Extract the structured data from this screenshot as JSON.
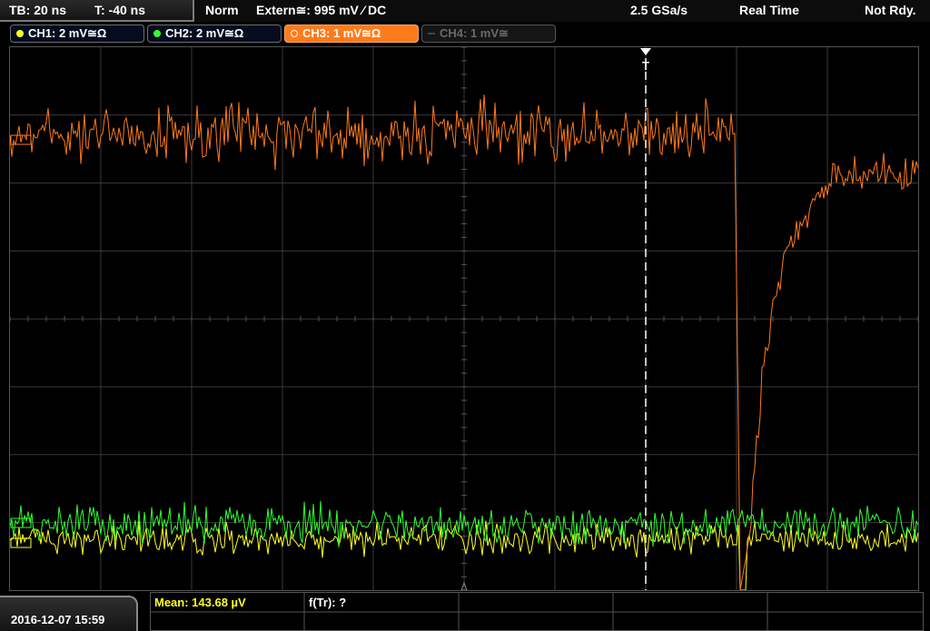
{
  "status": {
    "timebase": "TB: 20 ns",
    "trigger_time": "T: -40 ns",
    "mode": "Norm",
    "trigger_source": "Extern≅: 995 mV ⁄ DC",
    "sample_rate": "2.5 GSa/s",
    "acquisition": "Real Time",
    "state": "Not Rdy."
  },
  "channels": [
    {
      "label": "CH1: 2 mV≅Ω",
      "color": "#ffff20",
      "active": false
    },
    {
      "label": "CH2: 2 mV≅Ω",
      "color": "#30ff30",
      "active": false
    },
    {
      "label": "CH3: 1 mV≅Ω",
      "color": "#ff7a1a",
      "active": true
    },
    {
      "label": "CH4: 1 mV≅",
      "color": "#6a6a6a",
      "active": false
    }
  ],
  "trigger_marker": "T",
  "measurements": {
    "mean": "Mean: 143.68 µV",
    "f_tr": "f(Tr): ?"
  },
  "timestamp": "2016-12-07 15:59",
  "colors": {
    "ch1_trace": "#ffff20",
    "ch2_trace": "#30ff30",
    "ch3_trace": "#ff7a1a",
    "grid": "#3a3a3a",
    "background": "#000000"
  },
  "chart_data": {
    "type": "line",
    "grid_divisions": {
      "x": 10,
      "y": 8
    },
    "series": [
      {
        "name": "CH3",
        "description": "noisy baseline then sharp negative dip after trigger and exponential recovery",
        "baseline_div": -3.0,
        "dip_min_div": 4.0,
        "recovery_level_div": -2.6
      },
      {
        "name": "CH2",
        "description": "noise band",
        "baseline_div": 3.0
      },
      {
        "name": "CH1",
        "description": "noise band",
        "baseline_div": 3.2
      }
    ]
  }
}
